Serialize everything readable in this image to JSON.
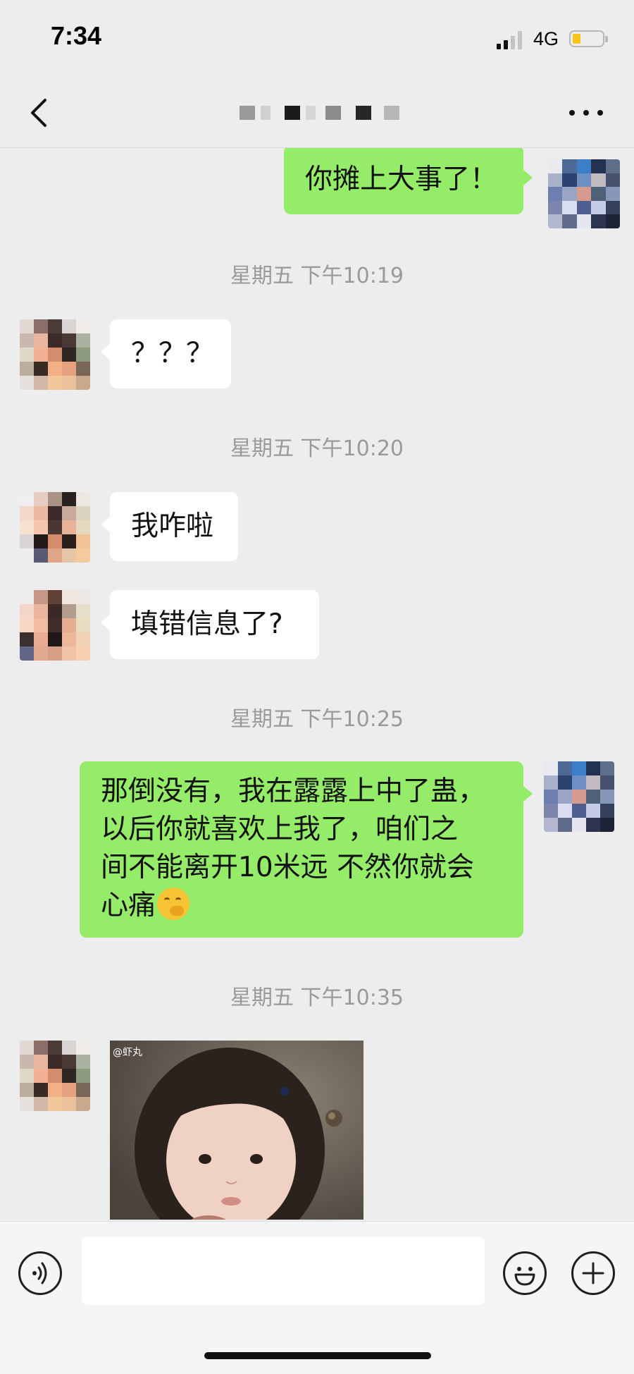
{
  "status_bar": {
    "time": "7:34",
    "network": "4G",
    "battery_level": 0.2,
    "icons": [
      "cellular-signal-icon",
      "battery-icon"
    ]
  },
  "nav": {
    "back_icon": "chevron-left-icon",
    "title_obscured": true,
    "more_icon": "ellipsis-icon"
  },
  "messages": [
    {
      "id": "m1",
      "side": "out",
      "text": "你摊上大事了！"
    },
    {
      "id": "t1",
      "type": "timestamp",
      "text": "星期五 下午10:19"
    },
    {
      "id": "m2",
      "side": "in",
      "text": "？？？"
    },
    {
      "id": "t2",
      "type": "timestamp",
      "text": "星期五 下午10:20"
    },
    {
      "id": "m3",
      "side": "in",
      "text": "我咋啦"
    },
    {
      "id": "m4",
      "side": "in",
      "text": "填错信息了?"
    },
    {
      "id": "t3",
      "type": "timestamp",
      "text": "星期五 下午10:25"
    },
    {
      "id": "m5",
      "side": "out",
      "lines": [
        "那倒没有，我在露露上中了蛊，",
        "以后你就喜欢上我了，咱们之",
        "间不能离开10米远 不然你就会",
        "心痛"
      ],
      "emoji": "thinking-face-emoji"
    },
    {
      "id": "t4",
      "type": "timestamp",
      "text": "星期五 下午10:35"
    },
    {
      "id": "m6",
      "side": "in",
      "type": "sticker",
      "sticker_desc": "child-photo-sticker",
      "watermark": "@虾丸"
    }
  ],
  "input_bar": {
    "voice_icon": "voice-input-icon",
    "text_value": "",
    "emoji_icon": "smiley-face-icon",
    "more_icon": "plus-circle-icon"
  },
  "colors": {
    "background": "#ededed",
    "outgoing_bubble": "#95ec69",
    "incoming_bubble": "#ffffff",
    "timestamp": "#9a9a9a"
  }
}
